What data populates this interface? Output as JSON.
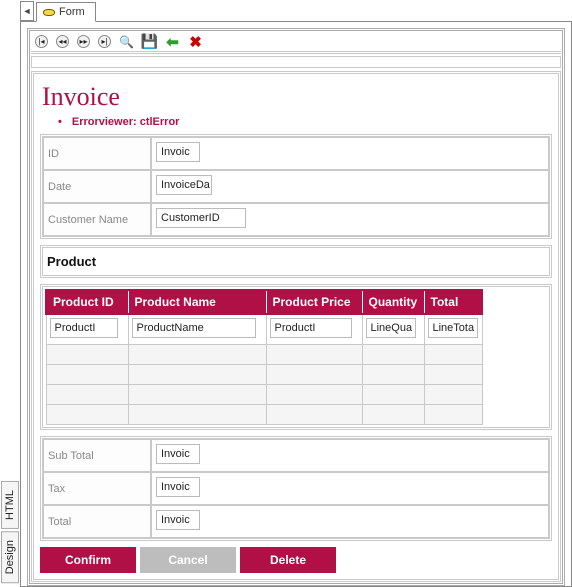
{
  "tab": {
    "label": "Form"
  },
  "vtabs": {
    "design": "Design",
    "html": "HTML"
  },
  "title": "Invoice",
  "error": "Errorviewer: ctlError",
  "header_fields": {
    "id": {
      "label": "ID",
      "value": "Invoic"
    },
    "date": {
      "label": "Date",
      "value": "InvoiceDa"
    },
    "cust": {
      "label": "Customer Name",
      "value": "CustomerID"
    }
  },
  "product_section_title": "Product",
  "grid": {
    "cols": {
      "pid": "Product ID",
      "pname": "Product Name",
      "pprice": "Product Price",
      "qty": "Quantity",
      "total": "Total"
    },
    "row0": {
      "pid": "ProductI",
      "pname": "ProductName",
      "pprice": "ProductI",
      "qty": "LineQua",
      "total": "LineTota"
    }
  },
  "footer_fields": {
    "sub": {
      "label": "Sub Total",
      "value": "Invoic"
    },
    "tax": {
      "label": "Tax",
      "value": "Invoic"
    },
    "total": {
      "label": "Total",
      "value": "Invoic"
    }
  },
  "buttons": {
    "confirm": "Confirm",
    "cancel": "Cancel",
    "delete": "Delete"
  }
}
